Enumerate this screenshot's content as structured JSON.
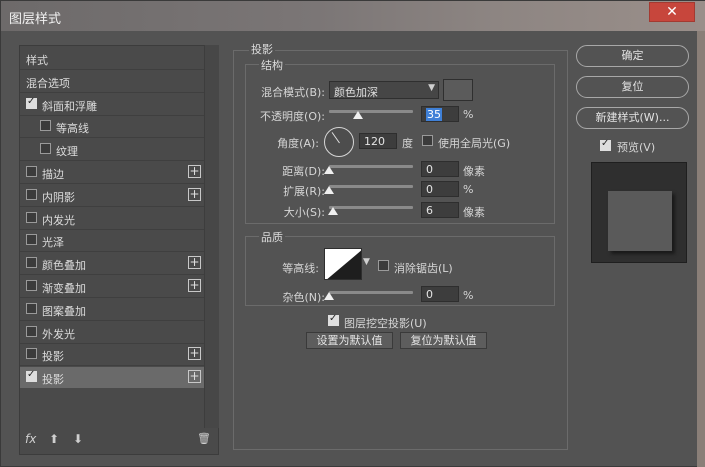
{
  "window": {
    "title": "图层样式",
    "close_glyph": "✕"
  },
  "left_panel": {
    "items": [
      {
        "label": "样式",
        "checkbox": false,
        "checked": false,
        "plus": false,
        "active": false
      },
      {
        "label": "混合选项",
        "checkbox": false,
        "checked": false,
        "plus": false,
        "active": false
      },
      {
        "label": "斜面和浮雕",
        "checkbox": true,
        "checked": true,
        "plus": false,
        "active": false
      },
      {
        "label": "等高线",
        "checkbox": true,
        "checked": false,
        "plus": false,
        "active": false
      },
      {
        "label": "纹理",
        "checkbox": true,
        "checked": false,
        "plus": false,
        "active": false
      },
      {
        "label": "描边",
        "checkbox": true,
        "checked": false,
        "plus": true,
        "active": false
      },
      {
        "label": "内阴影",
        "checkbox": true,
        "checked": false,
        "plus": true,
        "active": false
      },
      {
        "label": "内发光",
        "checkbox": true,
        "checked": false,
        "plus": false,
        "active": false
      },
      {
        "label": "光泽",
        "checkbox": true,
        "checked": false,
        "plus": false,
        "active": false
      },
      {
        "label": "颜色叠加",
        "checkbox": true,
        "checked": false,
        "plus": true,
        "active": false
      },
      {
        "label": "渐变叠加",
        "checkbox": true,
        "checked": false,
        "plus": true,
        "active": false
      },
      {
        "label": "图案叠加",
        "checkbox": true,
        "checked": false,
        "plus": false,
        "active": false
      },
      {
        "label": "外发光",
        "checkbox": true,
        "checked": false,
        "plus": false,
        "active": false
      },
      {
        "label": "投影",
        "checkbox": true,
        "checked": false,
        "plus": true,
        "active": false
      },
      {
        "label": "投影",
        "checkbox": true,
        "checked": true,
        "plus": true,
        "active": true
      }
    ],
    "bottom": {
      "fx": "fx",
      "up": "⬆",
      "down": "⬇",
      "trash": "🗑"
    }
  },
  "shadow": {
    "section_title": "投影",
    "structure": {
      "title": "结构",
      "blend_mode_label": "混合模式(B):",
      "blend_mode_value": "颜色加深",
      "opacity_label": "不透明度(O):",
      "opacity_value": "35",
      "opacity_level": 0.35,
      "percent": "%",
      "angle_label": "角度(A):",
      "angle_value": "120",
      "degree": "度",
      "global_light_label": "使用全局光(G)",
      "global_light_checked": false,
      "distance_label": "距离(D):",
      "distance_value": "0",
      "distance_unit": "像素",
      "spread_label": "扩展(R):",
      "spread_value": "0",
      "spread_unit": "%",
      "size_label": "大小(S):",
      "size_value": "6",
      "size_unit": "像素"
    },
    "quality": {
      "title": "品质",
      "contour_label": "等高线:",
      "antialias_label": "消除锯齿(L)",
      "antialias_checked": false,
      "noise_label": "杂色(N):",
      "noise_value": "0",
      "noise_unit": "%"
    },
    "knockout_label": "图层挖空投影(U)",
    "knockout_checked": true,
    "set_default_label": "设置为默认值",
    "reset_default_label": "复位为默认值"
  },
  "right_panel": {
    "ok_label": "确定",
    "reset_label": "复位",
    "new_style_label": "新建样式(W)...",
    "preview_label": "预览(V)",
    "preview_checked": true
  },
  "colors": {
    "dialog_bg": "#535353",
    "selection_blue": "#3f80d7",
    "close_red": "#c7463c",
    "shadow_color_swatch": "#5b5b5b"
  }
}
